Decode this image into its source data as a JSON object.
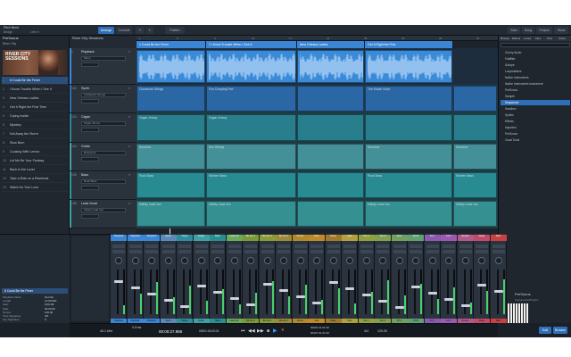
{
  "window": {
    "title": "Pitch Bend",
    "subtitle": "Bridge",
    "left_info": "Left: e"
  },
  "toolbar": {
    "arrangement_label": "Arrange",
    "console_label": "Console",
    "song_label": "Song",
    "project_label": "Project",
    "show_label": "Show",
    "right_buttons": [
      "Start",
      "Song",
      "Project",
      "Show"
    ]
  },
  "setlist": {
    "brand": "PreSonus",
    "project": "River City",
    "cover_text": "RIVER CITY SESSIONS",
    "songs": [
      {
        "n": "1",
        "title": "It Could Be the Fever"
      },
      {
        "n": "2",
        "title": "I Know Trouble When I See It"
      },
      {
        "n": "3",
        "title": "New Orleans Ladies"
      },
      {
        "n": "4",
        "title": "Get It Right the First Time"
      },
      {
        "n": "5",
        "title": "Crying Inside"
      },
      {
        "n": "6",
        "title": "Mystery"
      },
      {
        "n": "7",
        "title": "Not Away the Storm"
      },
      {
        "n": "8",
        "title": "Slow Burn"
      },
      {
        "n": "9",
        "title": "Cooking With Lemon"
      },
      {
        "n": "10",
        "title": "Let Me Be Your Fantasy"
      },
      {
        "n": "11",
        "title": "Back to the Lover"
      },
      {
        "n": "12",
        "title": "Take a Ride on a Riverboat"
      },
      {
        "n": "13",
        "title": "Watch for Your Love"
      }
    ]
  },
  "arrange": {
    "song_title": "River City Sessions",
    "players_label": "Players",
    "ruler_ticks": [
      "1",
      "5",
      "9",
      "13",
      "17",
      "21",
      "25",
      "29",
      "33",
      "37"
    ],
    "sections": [
      {
        "label": "1 Could Be the Fever",
        "color": "#3a85d6"
      },
      {
        "label": "1 I Know Trouble When I See It",
        "color": "#3a85d6"
      },
      {
        "label": "New Orleans Ladies",
        "color": "#3a85d6"
      },
      {
        "label": "Get It Right the First",
        "color": "#3a85d6"
      }
    ],
    "tracks": [
      {
        "n": "1",
        "name": "Playback",
        "color": "#3d8ae0",
        "device": "Mono",
        "kind": "audio"
      },
      {
        "n": "102",
        "name": "Synth",
        "color": "#2f6fb7",
        "device": "Clockwork Strings",
        "kind": "synth"
      },
      {
        "n": "103",
        "name": "Organ",
        "color": "#2a8a9a",
        "device": "Organ Jimmy",
        "kind": "organ"
      },
      {
        "n": "104",
        "name": "Guitar",
        "color": "#4aa0a8",
        "device": "Dirtorama",
        "kind": "guitar"
      },
      {
        "n": "105",
        "name": "Bass",
        "color": "#2a9aa0",
        "device": "Rock Bass",
        "kind": "bass"
      },
      {
        "n": "106",
        "name": "Lead Vocal",
        "color": "#3aa0a0",
        "device": "Infinity Lead Vox",
        "kind": "vocal"
      }
    ],
    "clips": {
      "synth": [
        "Clockwork Strings",
        "Fun Comping Pad",
        "",
        "The Model Voice",
        ""
      ],
      "organ": [
        "Organ Jimmy",
        "Organ Jimmy",
        "",
        "",
        ""
      ],
      "guitar": [
        "Sonance",
        "Iron Strings",
        "",
        "Sonance",
        "Sonance"
      ],
      "bass": [
        "Rock Bass",
        "Kitchen Bass",
        "",
        "Rock Bass",
        "Kitchen Bass"
      ],
      "vocal": [
        "Infinity Lead Vox",
        "Infinity Lead Vox",
        "",
        "Infinity Lead Vox",
        "Infinity Lead Vox"
      ]
    }
  },
  "browser": {
    "tabs": [
      "Browse",
      "Effects",
      "Loops",
      "Files",
      "Pool",
      "Cloud"
    ],
    "items": [
      "Cherry Audio",
      "Fabfilter",
      "iZotope",
      "Loopmasters",
      "Native Instruments",
      "Native Instruments Instrument",
      "PreSonus",
      "Sample",
      "Sequencer",
      "Sandbox",
      "Synths",
      "Effects",
      "Imported",
      "PreSonus",
      "Vocal Tools"
    ],
    "footer": "PreSonus",
    "footer2": "Instruments/Plugins"
  },
  "inspector": {
    "header": "It Could Be the Fever",
    "rows": [
      [
        "Playback Mode",
        "Normal"
      ],
      [
        "Length",
        "12:00.000"
      ],
      [
        "Gain",
        "0.00 dB"
      ],
      [
        "Start",
        "00:00:00"
      ],
      [
        "Tempo",
        "120.00"
      ],
      [
        "Time Signature",
        "4/4"
      ],
      [
        "Key Signature",
        "C"
      ]
    ]
  },
  "mixer": {
    "channels": [
      {
        "name": "Playback",
        "color": "#3a85d6"
      },
      {
        "name": "Playback",
        "color": "#3a85d6"
      },
      {
        "name": "Playback",
        "color": "#3a85d6"
      },
      {
        "name": "Synth",
        "color": "#5a8ab8"
      },
      {
        "name": "Organ",
        "color": "#2e8c9c"
      },
      {
        "name": "Guitar",
        "color": "#3ea0a4"
      },
      {
        "name": "Bass",
        "color": "#2a8e8e"
      },
      {
        "name": "Lead Vox",
        "color": "#6aaa5a"
      },
      {
        "name": "Bk Vox 1",
        "color": "#7a9a3a"
      },
      {
        "name": "Bk Vox 2",
        "color": "#8a9a3a"
      },
      {
        "name": "Bk Vox 3",
        "color": "#9a8a3a"
      },
      {
        "name": "Drums",
        "color": "#b08a2a"
      },
      {
        "name": "Kick",
        "color": "#c08a2a"
      },
      {
        "name": "Snare",
        "color": "#a07a2a"
      },
      {
        "name": "Hats",
        "color": "#b0a040"
      },
      {
        "name": "Tom 1",
        "color": "#90a040"
      },
      {
        "name": "Tom 2",
        "color": "#80a050"
      },
      {
        "name": "OH L",
        "color": "#70a060"
      },
      {
        "name": "OH R",
        "color": "#60a070"
      },
      {
        "name": "FX 1",
        "color": "#8a5ab0"
      },
      {
        "name": "FX 2",
        "color": "#9a5ab0"
      },
      {
        "name": "Reverb",
        "color": "#b05a8a"
      },
      {
        "name": "Delay",
        "color": "#c04a6a"
      },
      {
        "name": "Main",
        "color": "#c84040"
      }
    ]
  },
  "transport": {
    "timecode": "00:00:27.966",
    "bars": "00001.04.02.04",
    "tempo": "120.00",
    "sig": "4/4",
    "rate": "44.1 kHz",
    "cpu": "0.0 ms",
    "loop": "00001.01.01.00",
    "end": "00127.01.01.00"
  }
}
